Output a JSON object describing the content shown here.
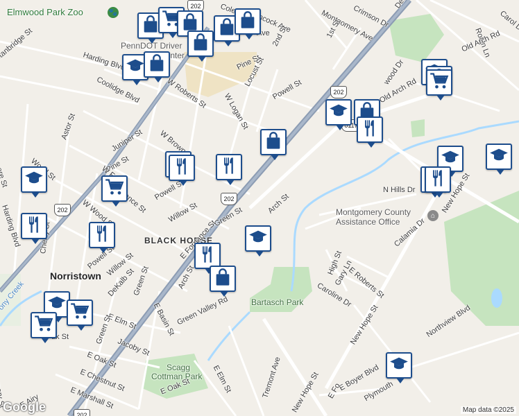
{
  "map": {
    "credit": "Map data ©2025",
    "logo": "Google"
  },
  "places": {
    "zoo": "Elmwood Park Zoo",
    "penndot_line1": "PennDOT Driver",
    "penndot_line2": "Center",
    "county_office_line1": "Montgomery County",
    "county_office_line2": "Assistance Office",
    "black_horse": "BLACK HORSE",
    "norristown": "Norristown",
    "bartasch_park": "Bartasch Park",
    "scagg_line1": "Scagg",
    "scagg_line2": "Cottman Park"
  },
  "streets": {
    "coles": "Coles",
    "hancock": "Hancock Ave",
    "crimson": "Crimson Dr",
    "montgomery": "Montgomery Ave",
    "dekalb_ne": "Dek",
    "carol": "Carol Dr",
    "robin": "Robin Ln",
    "stanbridge": "Stanbridge St",
    "harding_blvd_top": "Harding Blvd",
    "second": "2nd St",
    "first": "1st St",
    "ave_frag": "Ave",
    "old_arch_top": "Old Arch Rd",
    "old_arch": "Old Arch Rd",
    "wood_dr": "wood Dr",
    "coolidge": "Coolidge Blvd",
    "w_roberts": "W Roberts St",
    "pine_top": "Pine St",
    "locust": "Locust St",
    "w_logan": "W Logan St",
    "powell_top": "Powell St",
    "astor": "Astor St",
    "w_brown": "W Brown St",
    "juniper": "Juniper St",
    "wood_st": "Wood St",
    "pine_left": "Pine St",
    "w_fr": "W Fr",
    "ence_st": "ence St",
    "w_wood": "W Wood St",
    "powell_mid": "Powell St",
    "willow_mid": "Willow St",
    "green_st": "Green St",
    "arch_st": "Arch St",
    "n_hills": "N Hills Dr",
    "new_hope_top": "New Hope St",
    "calamia": "Calamia Dr",
    "e_roberts": "E Roberts St",
    "high_st": "High St",
    "gary_ln": "Gary Ln",
    "caroline": "Caroline Dr",
    "harding_blvd_left": "Harding Blvd",
    "cherry": "Cherry St",
    "powell_lower": "Powell St",
    "willow_lower": "Willow St",
    "ere_st": "ere St",
    "e_fornance": "E Fornance St",
    "dekalb": "DeKalb St",
    "green_lower": "Green St",
    "e_basin": "E Basin St",
    "arch_lower": "Arch St",
    "green_valley": "Green Valley Rd",
    "e_elm_left": "E Elm St",
    "jacoby": "Jacoby St",
    "green_low2": "Green St",
    "e_oak_left": "E Oak St",
    "e_chestnut": "E Chestnut St",
    "e_marshall": "E Marshall St",
    "e_oak_low": "E Oak St",
    "e_elm_low": "E Elm St",
    "tremont": "Tremont Ave",
    "new_hope_mid": "New Hope St",
    "northview": "Northview Blvd",
    "e_boyer": "E Boyer Blvd",
    "plymouth": "Plymouth",
    "new_hope_low": "New Hope St",
    "e_fo": "E Fo",
    "mery_st": "mery St",
    "e_airy": "E Airy",
    "ak_st": "ak St",
    "ony_creek": "ony Creek"
  },
  "shields": {
    "s202_a": "202",
    "s202_b": "202",
    "s202_c": "202",
    "s202_d": "202",
    "s202_e": "202",
    "s317": "0117"
  },
  "markers": [
    {
      "name": "shopping-bag-marker",
      "icon": "shopping-bag-icon"
    },
    {
      "name": "education-marker",
      "icon": "graduation-cap-icon"
    },
    {
      "name": "restaurant-marker",
      "icon": "fork-knife-icon"
    },
    {
      "name": "grocery-marker",
      "icon": "shopping-cart-icon"
    }
  ],
  "colors": {
    "marker_border": "#1d4d8c",
    "highway": "#8c9cb3",
    "park": "#c6e4bf",
    "water": "#aadaff",
    "background": "#f2efe9"
  }
}
